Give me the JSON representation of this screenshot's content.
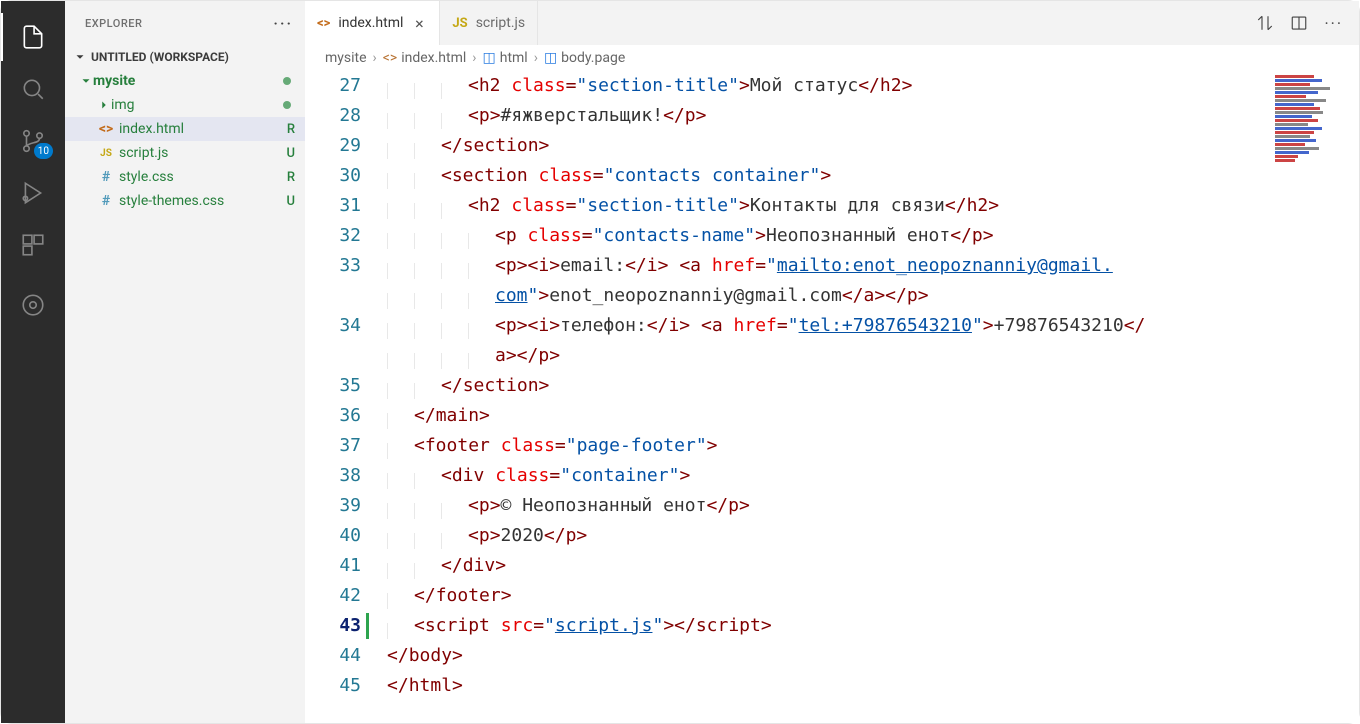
{
  "explorer": {
    "title": "EXPLORER",
    "workspace": "UNTITLED (WORKSPACE)",
    "rootFolder": "mysite",
    "imgFolder": "img",
    "files": {
      "indexHtml": {
        "name": "index.html",
        "status": "R"
      },
      "scriptJs": {
        "name": "script.js",
        "status": "U"
      },
      "styleCss": {
        "name": "style.css",
        "status": "R"
      },
      "styleThemes": {
        "name": "style-themes.css",
        "status": "U"
      }
    }
  },
  "scmBadge": "10",
  "tabs": {
    "indexHtml": "index.html",
    "scriptJs": "script.js"
  },
  "breadcrumb": {
    "p0": "mysite",
    "p1": "index.html",
    "p2": "html",
    "p3": "body.page"
  },
  "lineNumbers": {
    "l27": "27",
    "l28": "28",
    "l29": "29",
    "l30": "30",
    "l31": "31",
    "l32": "32",
    "l33": "33",
    "l33b": "",
    "l34": "34",
    "l34b": "",
    "l35": "35",
    "l36": "36",
    "l37": "37",
    "l38": "38",
    "l39": "39",
    "l40": "40",
    "l41": "41",
    "l42": "42",
    "l43": "43",
    "l44": "44",
    "l45": "45"
  },
  "code": {
    "l27_text": "Мой статус",
    "l28_text": "#яжверстальщик!",
    "l30_class": "contacts container",
    "l31_text": "Контакты для связи",
    "l32_class": "contacts-name",
    "l32_text": "Неопознанный енот",
    "l33_label": "email:",
    "l33_href1": "mailto:enot_neopoznanniy@gmail.",
    "l33b_href2": "com",
    "l33b_text": "enot_neopoznanniy@gmail.com",
    "l34_label": "телефон:",
    "l34_href": "tel:+79876543210",
    "l34_text": "+79876543210",
    "l37_class": "page-footer",
    "l38_class": "container",
    "l39_text": "© Неопознанный енот",
    "l40_text": "2020",
    "l43_src": "script.js",
    "sectionTitle": "section-title"
  }
}
